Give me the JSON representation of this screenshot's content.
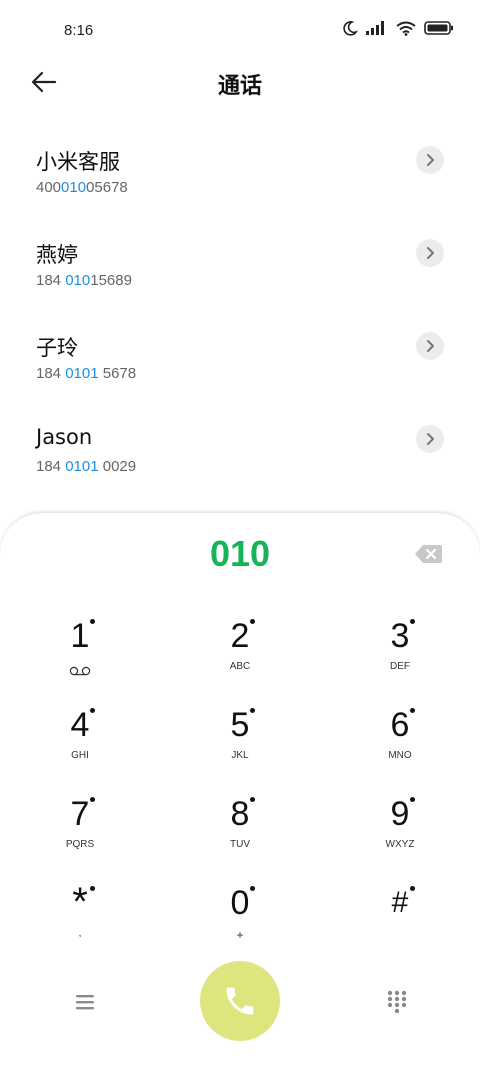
{
  "status_bar": {
    "time": "8:16",
    "icons": [
      "moon-icon",
      "signal-icon",
      "wifi-icon",
      "battery-icon"
    ]
  },
  "header": {
    "title": "通话",
    "back_icon": "arrow-left-icon"
  },
  "contacts": [
    {
      "name": "小米客服",
      "number_pre": "400",
      "number_match": "010",
      "number_post": "05678"
    },
    {
      "name": "燕婷",
      "number_pre": "184 ",
      "number_match": "010",
      "number_post": "15689"
    },
    {
      "name": "子玲",
      "number_pre": "184 ",
      "number_match": "0101",
      "number_post": " 5678"
    },
    {
      "name": "Jason",
      "number_pre": "184 ",
      "number_match": "0101",
      "number_post": " 0029"
    }
  ],
  "dialpad": {
    "input": "010",
    "keys": [
      {
        "digit": "1",
        "letters": ""
      },
      {
        "digit": "2",
        "letters": "ABC"
      },
      {
        "digit": "3",
        "letters": "DEF"
      },
      {
        "digit": "4",
        "letters": "GHI"
      },
      {
        "digit": "5",
        "letters": "JKL"
      },
      {
        "digit": "6",
        "letters": "MNO"
      },
      {
        "digit": "7",
        "letters": "PQRS"
      },
      {
        "digit": "8",
        "letters": "TUV"
      },
      {
        "digit": "9",
        "letters": "WXYZ"
      },
      {
        "digit": "*",
        "letters": ","
      },
      {
        "digit": "0",
        "letters": "+"
      },
      {
        "digit": "#",
        "letters": ""
      }
    ]
  },
  "colors": {
    "match_highlight": "#1d8fe1",
    "dialed_number": "#17b35a",
    "call_button": "#dde67e",
    "call_icon": "#ffffff"
  }
}
